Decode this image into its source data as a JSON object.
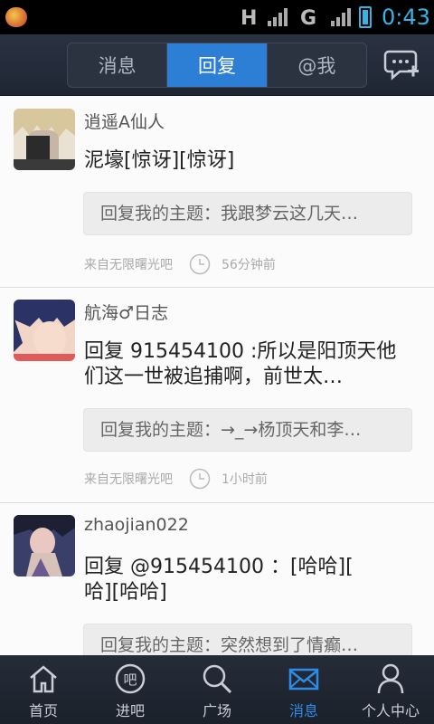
{
  "status": {
    "time": "0:43",
    "net1": "H",
    "net2": "G"
  },
  "tabs": [
    {
      "label": "消息"
    },
    {
      "label": "回复"
    },
    {
      "label": "@我"
    }
  ],
  "active_tab": "回复",
  "replies": [
    {
      "user": "逍遥A仙人",
      "text": "泥壕[惊讶][惊讶]",
      "quote": "回复我的主题：我跟梦云这几天…",
      "source": "来自无限曙光吧",
      "time": "56分钟前"
    },
    {
      "user": "航海♂日志",
      "text_line1": "回复 915454100 :所以是阳顶天他",
      "text_line2": "们这一世被追捕啊，前世太…",
      "quote": "回复我的主题：→_→杨顶天和李…",
      "source": "来自无限曙光吧",
      "time": "1小时前"
    },
    {
      "user": "zhaojian022",
      "text_line1": "回复 @915454100  ：[哈哈][",
      "text_line2": "哈][哈哈]",
      "quote": "回复我的主题：突然想到了情癫…"
    }
  ],
  "bottom_nav": [
    {
      "label": "首页",
      "icon": "home-icon"
    },
    {
      "label": "进吧",
      "icon": "enter-bar-icon"
    },
    {
      "label": "广场",
      "icon": "search-icon"
    },
    {
      "label": "消息",
      "icon": "mail-icon"
    },
    {
      "label": "个人中心",
      "icon": "person-icon"
    }
  ],
  "colors": {
    "accent": "#2d7fd6",
    "topbar": "#1f2633",
    "status_clock": "#33b5e5"
  }
}
